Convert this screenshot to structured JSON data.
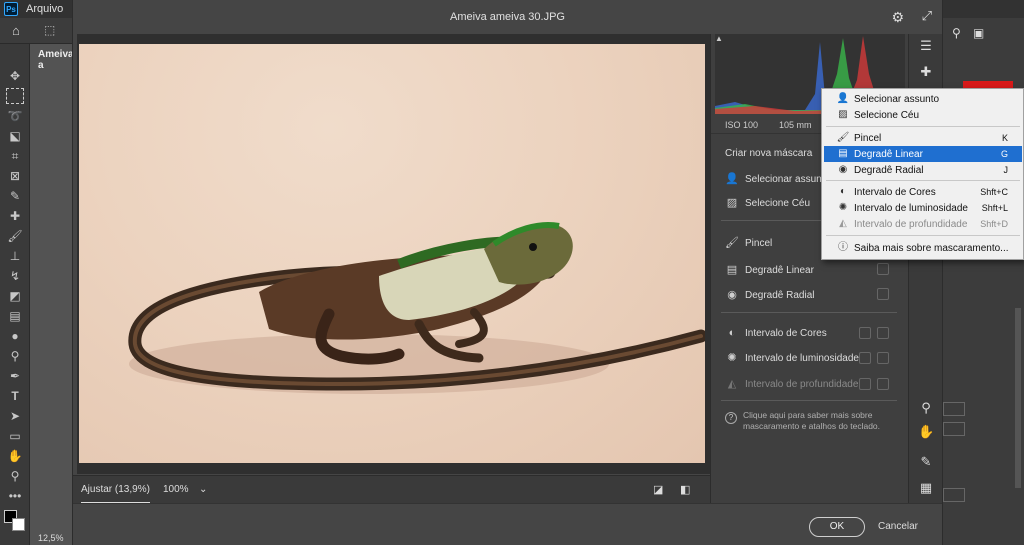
{
  "app": {
    "logo": "Ps",
    "menu": [
      "Arquivo",
      "E"
    ],
    "doc_tab": "Ameiva a",
    "zoom_status": "12,5%"
  },
  "dialog": {
    "title": "Ameiva ameiva 30.JPG",
    "footer": {
      "fit_label": "Ajustar (13,9%)",
      "zoom_label": "100%"
    },
    "ok_label": "OK",
    "cancel_label": "Cancelar"
  },
  "panel": {
    "exif": {
      "iso": "ISO 100",
      "focal": "105 mm"
    },
    "mask_title": "Criar nova máscara",
    "options": [
      {
        "label": "Selecionar assunto",
        "icon": "person-icon"
      },
      {
        "label": "Selecione Céu",
        "icon": "sky-icon"
      },
      {
        "label": "Pincel",
        "icon": "brush-icon"
      },
      {
        "label": "Degradê Linear",
        "icon": "linear-gradient-icon"
      },
      {
        "label": "Degradê Radial",
        "icon": "radial-gradient-icon"
      },
      {
        "label": "Intervalo de Cores",
        "icon": "color-range-icon"
      },
      {
        "label": "Intervalo de luminosidade",
        "icon": "luminance-range-icon"
      },
      {
        "label": "Intervalo de profundidade",
        "icon": "depth-range-icon"
      }
    ],
    "help_text": "Clique aqui para saber mais sobre mascaramento e atalhos do teclado."
  },
  "popup": {
    "items": [
      {
        "label": "Selecionar assunto",
        "shortcut": ""
      },
      {
        "label": "Selecione Céu",
        "shortcut": ""
      },
      {
        "label": "Pincel",
        "shortcut": "K"
      },
      {
        "label": "Degradê Linear",
        "shortcut": "G"
      },
      {
        "label": "Degradê Radial",
        "shortcut": "J"
      },
      {
        "label": "Intervalo de Cores",
        "shortcut": "Shft+C"
      },
      {
        "label": "Intervalo de luminosidade",
        "shortcut": "Shft+L"
      },
      {
        "label": "Intervalo de profundidade",
        "shortcut": "Shft+D"
      },
      {
        "label": "Saiba mais sobre mascaramento...",
        "shortcut": ""
      }
    ],
    "selected": "Degradê Linear"
  },
  "colors": {
    "accent": "#1f6fd0",
    "histogram_red": "#d23a3a",
    "histogram_green": "#3ab54a",
    "histogram_blue": "#3a6ad2"
  }
}
